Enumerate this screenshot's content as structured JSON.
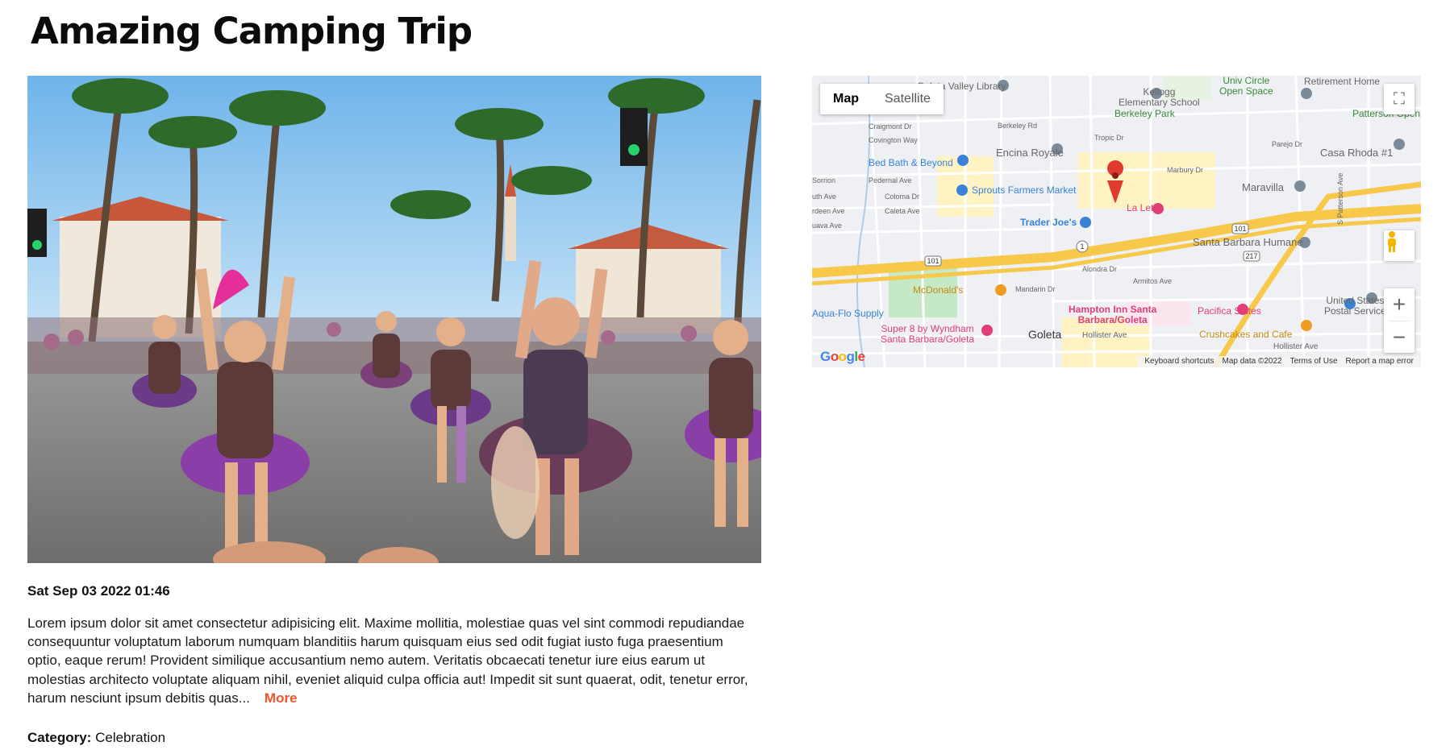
{
  "page": {
    "title": "Amazing Camping Trip",
    "date": "Sat Sep 03 2022 01:46",
    "description": "Lorem ipsum dolor sit amet consectetur adipisicing elit. Maxime mollitia, molestiae quas vel sint commodi repudiandae consequuntur voluptatum laborum numquam blanditiis harum quisquam eius sed odit fugiat iusto fuga praesentium optio, eaque rerum! Provident similique accusantium nemo autem. Veritatis obcaecati tenetur iure eius earum ut molestias architecto voluptate aliquam nihil, eveniet aliquid culpa officia aut! Impedit sit sunt quaerat, odit, tenetur error, harum nesciunt ipsum debitis quas...",
    "more_label": "More",
    "category_label": "Category:",
    "category_value": "Celebration"
  },
  "map": {
    "type_map": "Map",
    "type_satellite": "Satellite",
    "fullscreen_icon": "fullscreen-icon",
    "zoom_in": "+",
    "zoom_out": "−",
    "logo": "Google",
    "attribution": {
      "shortcuts": "Keyboard shortcuts",
      "data": "Map data ©2022",
      "terms": "Terms of Use",
      "report": "Report a map error"
    },
    "labels": {
      "valley_library": "Goleta Valley Library",
      "univ_circle": "Univ Circle\nOpen Space",
      "retirement_home": "Retirement Home",
      "kellogg": "Kellogg\nElementary School",
      "berkeley_park": "Berkeley Park",
      "patterson_open": "Patterson Open",
      "encina": "Encina Royale",
      "casa_rhoda": "Casa Rhoda #1",
      "bed_bath": "Bed Bath & Beyond",
      "sprouts": "Sprouts Farmers Market",
      "maravilla": "Maravilla",
      "leta": "La Leta",
      "trader_joes": "Trader Joe's",
      "santa_barbara_humane": "Santa Barbara Humane",
      "aqua_flo": "Aqua-Flo Supply",
      "mcdonalds": "McDonald's",
      "hampton": "Hampton Inn Santa\nBarbara/Goleta",
      "pacifica": "Pacifica Suites",
      "usps": "United States\nPostal Service",
      "super8": "Super 8 by Wyndham\nSanta Barbara/Goleta",
      "goleta": "Goleta",
      "crushcakes": "Crushcakes and Cafe",
      "hollister_ave": "Hollister Ave",
      "berkeley_rd": "Berkeley Rd",
      "craigmont": "Craigmont Dr",
      "covington": "Covington Way",
      "pedernal": "Pedernal Ave",
      "coloma": "Coloma Dr",
      "caleta": "Caleta Ave",
      "alondra": "Alondra Dr",
      "armitos": "Armitos Ave",
      "mandarin": "Mandarin Dr",
      "tropic": "Tropic Dr",
      "marbury": "Marbury Dr",
      "parejo": "Parejo Dr",
      "hwy101": "101",
      "hwy1": "1",
      "hwy217": "217",
      "s_patterson": "S Patterson Ave",
      "sorrion": "Sorrion",
      "uth_ave": "uth Ave",
      "rdeen": "rdeen Ave",
      "uava": "uava Ave"
    }
  },
  "colors": {
    "accent": "#f0542a",
    "highway": "#f7c84a",
    "park": "#c5e8c5",
    "pin": "#e03a2f"
  }
}
